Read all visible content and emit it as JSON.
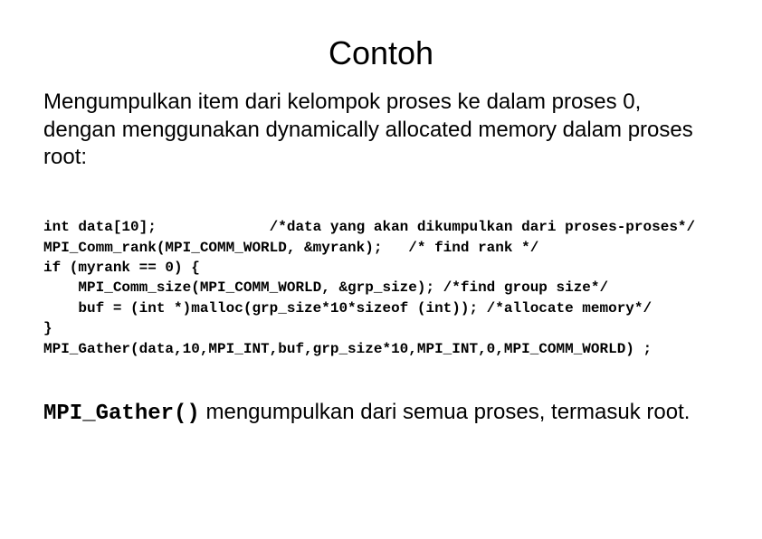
{
  "title": "Contoh",
  "paragraph": "Mengumpulkan item dari kelompok proses ke dalam proses 0, dengan menggunakan dynamically allocated memory dalam proses root:",
  "code": "int data[10];             /*data yang akan dikumpulkan dari proses-proses*/\nMPI_Comm_rank(MPI_COMM_WORLD, &myrank);   /* find rank */\nif (myrank == 0) {\n    MPI_Comm_size(MPI_COMM_WORLD, &grp_size); /*find group size*/\n    buf = (int *)malloc(grp_size*10*sizeof (int)); /*allocate memory*/\n}\nMPI_Gather(data,10,MPI_INT,buf,grp_size*10,MPI_INT,0,MPI_COMM_WORLD) ;",
  "closing_mono": "MPI_Gather()",
  "closing_rest": " mengumpulkan dari semua proses, termasuk root."
}
